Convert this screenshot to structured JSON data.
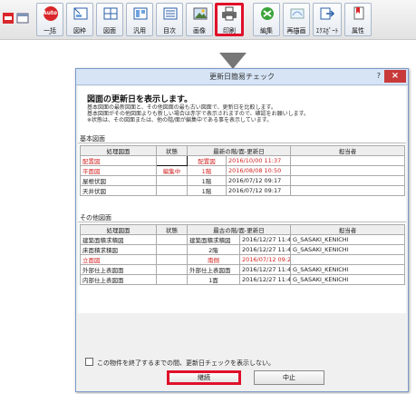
{
  "toolbar": {
    "buttons": [
      {
        "label": ""
      },
      {
        "label": "一括"
      },
      {
        "label": "図枠"
      },
      {
        "label": "図面"
      },
      {
        "label": "汎用"
      },
      {
        "label": "目次"
      },
      {
        "label": "画像"
      },
      {
        "label": "印刷"
      },
      {
        "label": "編集"
      },
      {
        "label": "再描画"
      },
      {
        "label": "ｴｸｽﾎﾟｰﾄ"
      },
      {
        "label": "属性"
      }
    ],
    "auto_badge": "Auto",
    "dropdown_glyph": "⌄",
    "highlight_color": "#e0102a"
  },
  "dialog": {
    "title": "更新日簡易チェック",
    "help": "?",
    "close": "×",
    "heading": "図面の更新日を表示します。",
    "description": [
      "基本図面の最新図面と、その他図面の最も古い図面で、更新日を比較します。",
      "基本図面がその他図面よりも新しい場合は赤字で表示されますので、確認をお願いします。",
      "※状態は、その図面または、他の階/面が編集中である事を表示しています。"
    ],
    "basic_section": {
      "label": "基本図面",
      "headers": [
        "処理図面",
        "状態",
        "最新の階/面-更新日",
        "担当者"
      ],
      "rows": [
        {
          "name": "配置図",
          "status": "",
          "floor": "配置図",
          "date": "2016/10/00 11:37",
          "person": ""
        },
        {
          "name": "平面図",
          "status": "編集中",
          "floor": "1階",
          "date": "2016/08/08 10:50",
          "person": ""
        },
        {
          "name": "屋根伏図",
          "status": "",
          "floor": "1階",
          "date": "2016/07/12 09:17",
          "person": ""
        },
        {
          "name": "天井伏図",
          "status": "",
          "floor": "1階",
          "date": "2016/07/12 09:17",
          "person": ""
        }
      ]
    },
    "other_section": {
      "label": "その他図面",
      "headers": [
        "処理図面",
        "状態",
        "最古の階/面-更新日",
        "担当者"
      ],
      "rows": [
        {
          "name": "建築面積求積図",
          "status": "",
          "floor": "建築面積求積図",
          "date": "2016/12/27 11:40",
          "person": "G_SASAKI_KENICHI"
        },
        {
          "name": "床面積求積図",
          "status": "",
          "floor": "2階",
          "date": "2016/12/27 11:40",
          "person": "G_SASAKI_KENICHI"
        },
        {
          "name": "立面図",
          "status": "",
          "floor": "南側",
          "date": "2016/07/12 09:20",
          "person": ""
        },
        {
          "name": "外部仕上表図面",
          "status": "",
          "floor": "外部仕上表図面",
          "date": "2016/12/27 11:43",
          "person": "G_SASAKI_KENICHI"
        },
        {
          "name": "内部仕上表図面",
          "status": "",
          "floor": "1面",
          "date": "2016/12/27 11:43",
          "person": "G_SASAKI_KENICHI"
        }
      ]
    },
    "checkbox_label": "この物件を終了するまでの間、更新日チェックを表示しない。",
    "continue_button": "継続",
    "cancel_button": "中止"
  }
}
